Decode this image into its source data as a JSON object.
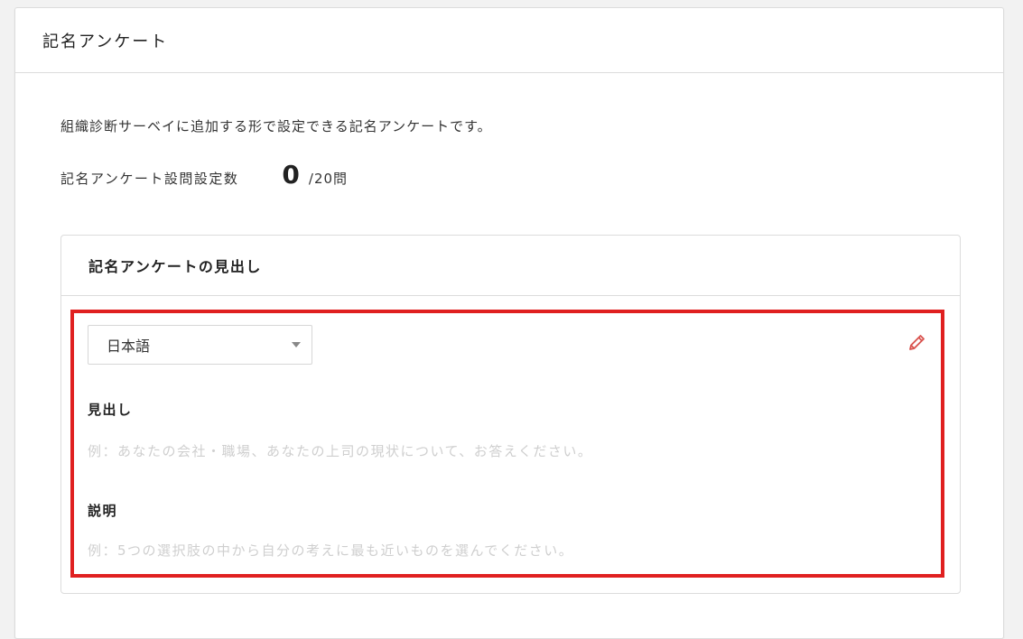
{
  "card": {
    "title": "記名アンケート",
    "description": "組織診断サーベイに追加する形で設定できる記名アンケートです。",
    "count_label": "記名アンケート設問設定数",
    "count_value": "0",
    "count_total": "/20問"
  },
  "heading_section": {
    "title": "記名アンケートの見出し",
    "language_select": {
      "selected": "日本語"
    },
    "edit_icon": "pencil-icon",
    "heading": {
      "label": "見出し",
      "placeholder": "例：あなたの会社・職場、あなたの上司の現状について、お答えください。"
    },
    "explanation": {
      "label": "説明",
      "placeholder": "例：5つの選択肢の中から自分の考えに最も近いものを選んでください。"
    }
  },
  "colors": {
    "highlight": "#e02020",
    "edit_icon": "#d9534f"
  }
}
